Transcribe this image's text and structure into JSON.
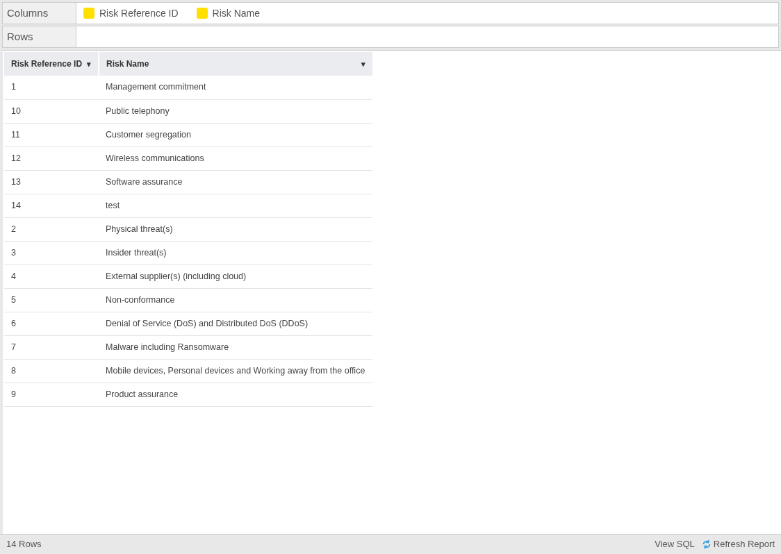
{
  "shelves": [
    {
      "label": "Columns",
      "chips": [
        {
          "label": "Risk Reference ID",
          "color": "#ffe000"
        },
        {
          "label": "Risk Name",
          "color": "#ffe000"
        }
      ]
    },
    {
      "label": "Rows"
    }
  ],
  "table": {
    "columns": [
      {
        "label": "Risk Reference ID",
        "sort": "▾"
      },
      {
        "label": "Risk Name",
        "sort": "▾"
      }
    ],
    "rows": [
      [
        "1",
        "Management commitment"
      ],
      [
        "10",
        "Public telephony"
      ],
      [
        "11",
        "Customer segregation"
      ],
      [
        "12",
        "Wireless communications"
      ],
      [
        "13",
        "Software assurance"
      ],
      [
        "14",
        "test"
      ],
      [
        "2",
        "Physical threat(s)"
      ],
      [
        "3",
        "Insider threat(s)"
      ],
      [
        "4",
        "External supplier(s) (including cloud)"
      ],
      [
        "5",
        "Non-conformance"
      ],
      [
        "6",
        "Denial of Service (DoS) and Distributed DoS (DDoS)"
      ],
      [
        "7",
        "Malware including Ransomware"
      ],
      [
        "8",
        "Mobile devices, Personal devices and Working away from the office"
      ],
      [
        "9",
        "Product assurance"
      ]
    ]
  },
  "status_bar": {
    "row_count": "14 Rows",
    "view_sql": "View SQL",
    "refresh": "Refresh Report"
  }
}
